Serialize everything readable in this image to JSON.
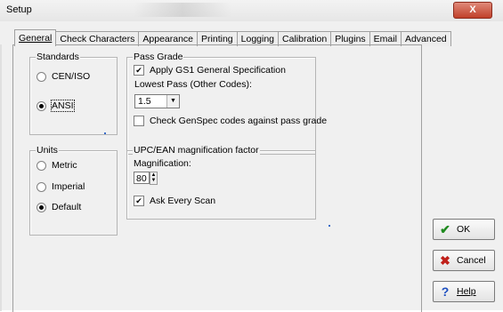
{
  "window": {
    "title": "Setup",
    "close_glyph": "X"
  },
  "tabs": [
    "General",
    "Check Characters",
    "Appearance",
    "Printing",
    "Logging",
    "Calibration",
    "Plugins",
    "Email",
    "Advanced"
  ],
  "standards": {
    "label": "Standards",
    "options": [
      "CEN/ISO",
      "ANSI"
    ],
    "selected": "ANSI"
  },
  "pass_grade": {
    "label": "Pass Grade",
    "apply_gs1": "Apply GS1 General Specification",
    "apply_gs1_checked": true,
    "lowest_pass_label": "Lowest Pass (Other Codes):",
    "lowest_pass_value": "1.5",
    "check_genspec": "Check GenSpec codes against pass grade",
    "check_genspec_checked": false
  },
  "units": {
    "label": "Units",
    "options": [
      "Metric",
      "Imperial",
      "Default"
    ],
    "selected": "Default"
  },
  "magnification": {
    "label": "UPC/EAN magnification factor",
    "field_label": "Magnification:",
    "value": "80",
    "ask_every_scan": "Ask Every Scan",
    "ask_every_scan_checked": true
  },
  "buttons": {
    "ok": "OK",
    "cancel": "Cancel",
    "help": "Help"
  },
  "icons": {
    "ok": "checkmark-icon",
    "cancel": "x-icon",
    "help": "question-icon"
  },
  "colors": {
    "ok_icon": "#1f8a1f",
    "cancel_icon": "#c0201a",
    "help_icon": "#1d4fc0",
    "close_button": "#c0402a"
  }
}
